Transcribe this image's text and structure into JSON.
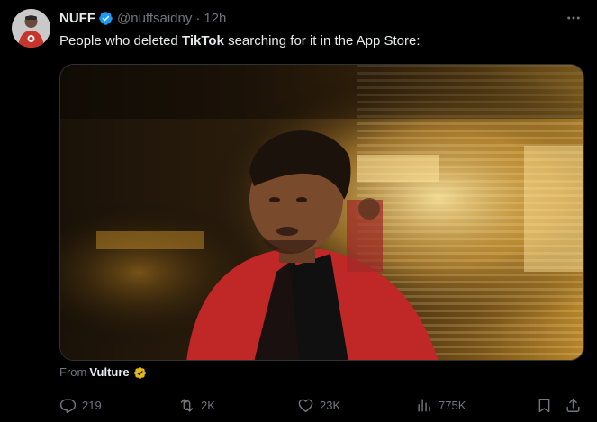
{
  "tweet": {
    "display_name": "NUFF",
    "handle": "@nuffsaidny",
    "separator": "·",
    "time": "12h",
    "text": {
      "before": "People who deleted ",
      "bold": "TikTok",
      "after": " searching for it in the App Store:"
    },
    "media": {
      "from_label": "From",
      "from_source": "Vulture"
    }
  },
  "actions": {
    "replies": "219",
    "reposts": "2K",
    "likes": "23K",
    "views": "775K"
  },
  "icons": {
    "avatar": "profile-avatar",
    "verified": "verified-badge-blue",
    "more": "more-horizontal-icon",
    "source_badge": "verified-badge-gold",
    "reply": "reply-icon",
    "repost": "repost-icon",
    "like": "heart-icon",
    "views": "views-chart-icon",
    "bookmark": "bookmark-icon",
    "share": "share-icon"
  },
  "colors": {
    "background": "#000000",
    "text_primary": "#e7e9ea",
    "text_secondary": "#71767b",
    "verified_blue": "#1d9bf0",
    "verified_gold": "#e2b719",
    "border": "#2f3336"
  }
}
